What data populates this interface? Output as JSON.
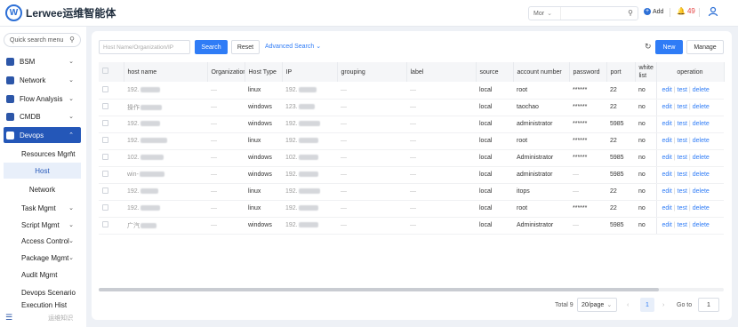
{
  "app": {
    "brand": "Lerwee运维智能体",
    "logo_letter": "W"
  },
  "topbar": {
    "scope": "Mor",
    "add_label": "Add",
    "alert_count": "49",
    "icons": {
      "search": "search-icon",
      "bell": "bell-icon",
      "user": "user-icon"
    }
  },
  "sidebar": {
    "search_placeholder": "Quick search menu",
    "items": [
      {
        "label": "BSM",
        "expandable": true
      },
      {
        "label": "Network",
        "expandable": true
      },
      {
        "label": "Flow Analysis",
        "expandable": true
      },
      {
        "label": "CMDB",
        "expandable": true
      },
      {
        "label": "Devops",
        "expandable": true,
        "active": true
      }
    ],
    "subitems": [
      {
        "label": "Resources Mgmt",
        "expandable": true
      },
      {
        "label": "Host",
        "selected": true
      },
      {
        "label": "Network"
      },
      {
        "label": "Task Mgmt",
        "expandable": true
      },
      {
        "label": "Script Mgmt",
        "expandable": true
      },
      {
        "label": "Access Control",
        "expandable": true
      },
      {
        "label": "Package Mgmt",
        "expandable": true
      },
      {
        "label": "Audit Mgmt"
      },
      {
        "label": "Devops Scenario"
      },
      {
        "label": "Execution Hist"
      }
    ],
    "footer": "运维知识"
  },
  "toolbar": {
    "filter_placeholder": "Host Name/Organization/IP",
    "search_label": "Search",
    "reset_label": "Reset",
    "advanced_label": "Advanced Search",
    "new_label": "New",
    "manage_label": "Manage"
  },
  "table": {
    "columns": [
      "host name",
      "Organization",
      "Host Type",
      "IP",
      "grouping",
      "label",
      "source",
      "account number",
      "password",
      "port",
      "white list",
      "operation"
    ],
    "rows": [
      {
        "host": "192.",
        "org": "—",
        "type": "linux",
        "ip": "192.",
        "grouping": "—",
        "label": "—",
        "source": "local",
        "account": "root",
        "password": "******",
        "port": "22",
        "white": "no"
      },
      {
        "host": "操作",
        "org": "—",
        "type": "windows",
        "ip": "123.",
        "grouping": "—",
        "label": "—",
        "source": "local",
        "account": "taochao",
        "password": "******",
        "port": "22",
        "white": "no"
      },
      {
        "host": "192.",
        "org": "—",
        "type": "windows",
        "ip": "192.",
        "grouping": "—",
        "label": "—",
        "source": "local",
        "account": "administrator",
        "password": "******",
        "port": "5985",
        "white": "no"
      },
      {
        "host": "192.",
        "org": "—",
        "type": "linux",
        "ip": "192.",
        "grouping": "—",
        "label": "—",
        "source": "local",
        "account": "root",
        "password": "******",
        "port": "22",
        "white": "no"
      },
      {
        "host": "102.",
        "org": "—",
        "type": "windows",
        "ip": "102.",
        "grouping": "—",
        "label": "—",
        "source": "local",
        "account": "Administrator",
        "password": "******",
        "port": "5985",
        "white": "no"
      },
      {
        "host": "win-",
        "org": "—",
        "type": "windows",
        "ip": "192.",
        "grouping": "—",
        "label": "—",
        "source": "local",
        "account": "administrator",
        "password": "—",
        "port": "5985",
        "white": "no"
      },
      {
        "host": "192.",
        "org": "—",
        "type": "linux",
        "ip": "192.",
        "grouping": "—",
        "label": "—",
        "source": "local",
        "account": "itops",
        "password": "—",
        "port": "22",
        "white": "no"
      },
      {
        "host": "192.",
        "org": "—",
        "type": "linux",
        "ip": "192.",
        "grouping": "—",
        "label": "—",
        "source": "local",
        "account": "root",
        "password": "******",
        "port": "22",
        "white": "no"
      },
      {
        "host": "广汽",
        "org": "—",
        "type": "windows",
        "ip": "192.",
        "grouping": "—",
        "label": "—",
        "source": "local",
        "account": "Administrator",
        "password": "—",
        "port": "5985",
        "white": "no"
      }
    ],
    "operations": {
      "edit": "edit",
      "test": "test",
      "delete": "delete"
    }
  },
  "pagination": {
    "total_label": "Total 9",
    "page_size": "20/page",
    "current_page": "1",
    "goto_label": "Go to",
    "goto_value": "1"
  }
}
